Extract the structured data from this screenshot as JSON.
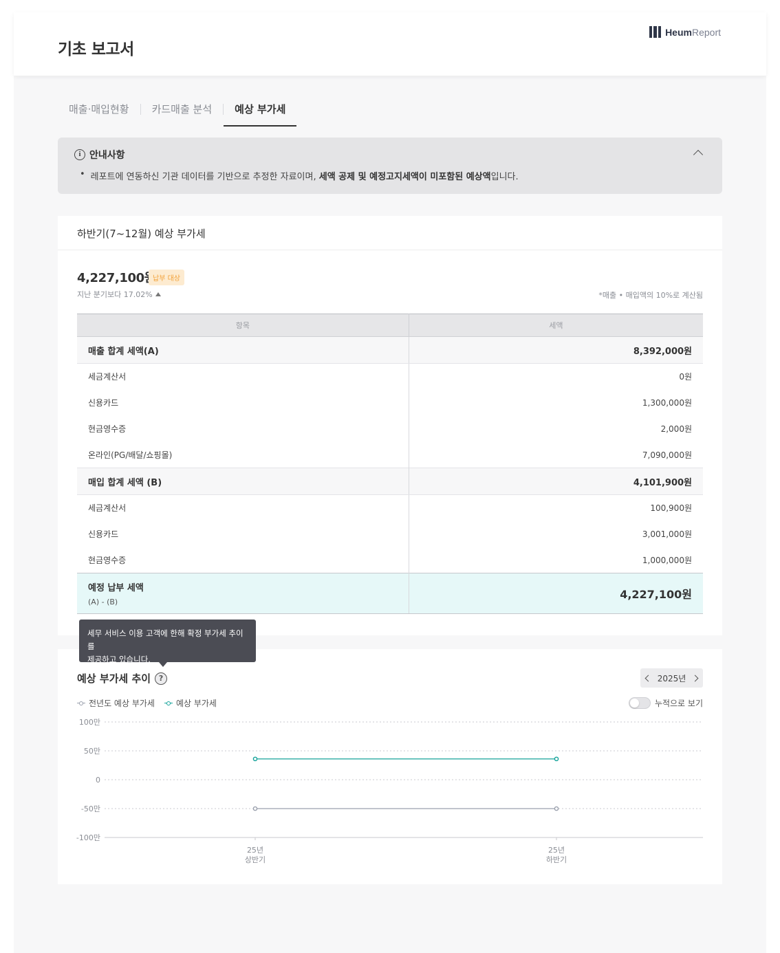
{
  "header": {
    "title": "기초 보고서",
    "logo_bold": "Heum",
    "logo_light": "Report"
  },
  "tabs": [
    {
      "label": "매출·매입현황",
      "active": false
    },
    {
      "label": "카드매출 분석",
      "active": false
    },
    {
      "label": "예상 부가세",
      "active": true
    }
  ],
  "notice": {
    "title": "안내사항",
    "text_prefix": "레포트에 연동하신 기관 데이터를 기반으로 추정한 자료이며, ",
    "text_bold": "세액 공제 및 예정고지세액이 미포함된 예상액",
    "text_suffix": "입니다."
  },
  "summary": {
    "title": "하반기(7~12월) 예상 부가세",
    "amount": "4,227,100원",
    "badge": "납부 대상",
    "compare": "지난 분기보다 17.02%",
    "calc_note": "*매출 • 매입액의 10%로 계산됨",
    "col_item": "항목",
    "col_tax": "세액",
    "sales_total_label": "매출 합계 세액(A)",
    "sales_total": "8,392,000원",
    "sales": [
      {
        "label": "세금계산서",
        "value": "0원"
      },
      {
        "label": "신용카드",
        "value": "1,300,000원"
      },
      {
        "label": "현금영수증",
        "value": "2,000원"
      },
      {
        "label": "온라인(PG/배달/쇼핑몰)",
        "value": "7,090,000원"
      }
    ],
    "purchase_total_label": "매입 합계 세액 (B)",
    "purchase_total": "4,101,900원",
    "purchases": [
      {
        "label": "세금계산서",
        "value": "100,900원"
      },
      {
        "label": "신용카드",
        "value": "3,001,000원"
      },
      {
        "label": "현금영수증",
        "value": "1,000,000원"
      }
    ],
    "payable_label": "예정 납부 세액",
    "payable_formula": "(A) - (B)",
    "payable": "4,227,100원"
  },
  "trend": {
    "tooltip_line1": "세무 서비스 이용 고객에 한해 확정 부가세 추이를",
    "tooltip_line2": "제공하고 있습니다.",
    "title": "예상 부가세 추이",
    "help_icon": "?",
    "year": "2025년",
    "legend_prev": "전년도 예상 부가세",
    "legend_cur": "예상 부가세",
    "cumulative_label": "누적으로 보기",
    "cumulative_on": false
  },
  "chart_data": {
    "type": "line",
    "y_ticks": [
      "100만",
      "50만",
      "0",
      "-50만",
      "-100만"
    ],
    "ylim": [
      -1000000,
      1000000
    ],
    "categories": [
      [
        "25년",
        "상반기"
      ],
      [
        "25년",
        "하반기"
      ]
    ],
    "series": [
      {
        "name": "전년도 예상 부가세",
        "color": "#9aa0ad",
        "values": [
          -500000,
          -500000
        ]
      },
      {
        "name": "예상 부가세",
        "color": "#14a39a",
        "values": [
          360000,
          360000
        ]
      }
    ],
    "grid": true
  }
}
